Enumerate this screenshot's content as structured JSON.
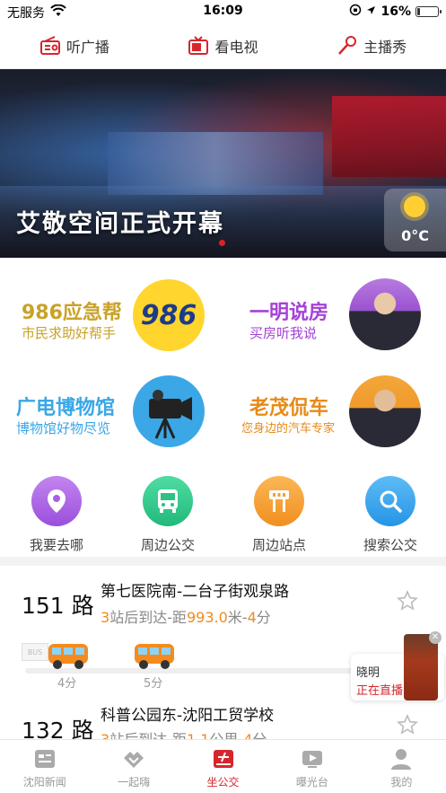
{
  "status_bar": {
    "carrier": "无服务",
    "time": "16:09",
    "battery_text": "16%",
    "battery_level": 0.16
  },
  "top_nav": [
    {
      "label": "听广播",
      "icon": "radio-icon"
    },
    {
      "label": "看电视",
      "icon": "tv-icon"
    },
    {
      "label": "主播秀",
      "icon": "microphone-icon"
    }
  ],
  "banner": {
    "title": "艾敬空间正式开幕",
    "weather_temp": "0°C"
  },
  "features": [
    {
      "title": "986应急帮",
      "subtitle": "市民求助好帮手",
      "title_color": "#c9a227",
      "sub_color": "#c9a227"
    },
    {
      "title": "一明说房",
      "subtitle": "买房听我说",
      "title_color": "#a442d6",
      "sub_color": "#a442d6"
    },
    {
      "title": "广电博物馆",
      "subtitle": "博物馆好物尽览",
      "title_color": "#3ba7e6",
      "sub_color": "#3ba7e6"
    },
    {
      "title": "老茂侃车",
      "subtitle": "您身边的汽车专家",
      "title_color": "#e88a17",
      "sub_color": "#e88a17"
    }
  ],
  "feature_logo_text": "986",
  "services": [
    {
      "label": "我要去哪",
      "icon": "location-pin-icon",
      "color": "#b065e6"
    },
    {
      "label": "周边公交",
      "icon": "bus-icon",
      "color": "#34c98e"
    },
    {
      "label": "周边站点",
      "icon": "bus-stop-icon",
      "color": "#f5a23a"
    },
    {
      "label": "搜索公交",
      "icon": "search-icon",
      "color": "#3aa8f0"
    }
  ],
  "routes": [
    {
      "number": "151",
      "unit": "路",
      "name": "第七医院南-二台子街观泉路",
      "stops": "3",
      "stops_suffix": "站后到达-距",
      "distance": "993.0",
      "distance_unit": "米-",
      "minutes": "4",
      "minutes_unit": "分"
    },
    {
      "number": "132",
      "unit": "路",
      "name": "科普公园东-沈阳工贸学校",
      "stops": "3",
      "stops_suffix": "站后到达-距",
      "distance": "1.1",
      "distance_unit": "公里-",
      "minutes": "4",
      "minutes_unit": "分"
    }
  ],
  "bus_times": [
    "4分",
    "5分"
  ],
  "live": {
    "name": "晓明",
    "status": "正在直播"
  },
  "tabs": [
    {
      "label": "沈阳新闻",
      "icon": "news-icon"
    },
    {
      "label": "一起嗨",
      "icon": "handshake-icon"
    },
    {
      "label": "坐公交",
      "icon": "bus-tab-icon",
      "active": true
    },
    {
      "label": "曝光台",
      "icon": "video-icon"
    },
    {
      "label": "我的",
      "icon": "profile-icon"
    }
  ],
  "colors": {
    "accent_red": "#d6262c",
    "orange_highlight": "#f08a1c"
  }
}
